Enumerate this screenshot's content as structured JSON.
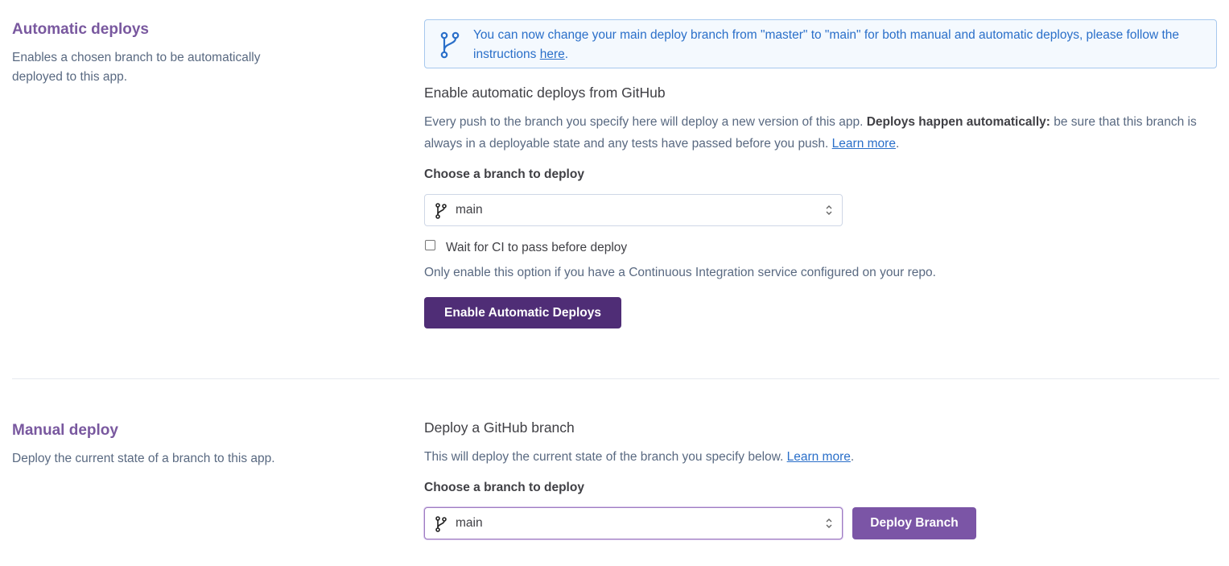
{
  "automatic": {
    "title": "Automatic deploys",
    "description": "Enables a chosen branch to be automatically deployed to this app.",
    "banner": {
      "text_before": "You can now change your main deploy branch from \"master\" to \"main\" for both manual and automatic deploys, please follow the instructions ",
      "link": "here",
      "text_after": "."
    },
    "heading": "Enable automatic deploys from GitHub",
    "para_before": "Every push to the branch you specify here will deploy a new version of this app. ",
    "para_bold": "Deploys happen automatically:",
    "para_after": " be sure that this branch is always in a deployable state and any tests have passed before you push. ",
    "learn_more": "Learn more",
    "period": ".",
    "branch_label": "Choose a branch to deploy",
    "branch_value": "main",
    "ci_label": "Wait for CI to pass before deploy",
    "ci_note": "Only enable this option if you have a Continuous Integration service configured on your repo.",
    "button": "Enable Automatic Deploys"
  },
  "manual": {
    "title": "Manual deploy",
    "description": "Deploy the current state of a branch to this app.",
    "heading": "Deploy a GitHub branch",
    "para": "This will deploy the current state of the branch you specify below. ",
    "learn_more": "Learn more",
    "period": ".",
    "branch_label": "Choose a branch to deploy",
    "branch_value": "main",
    "button": "Deploy Branch"
  },
  "colors": {
    "accent": "#79589f",
    "primary_button": "#4f2d76",
    "secondary_button": "#7b55a6",
    "link": "#2a6fc9",
    "banner_bg": "#f4f9fe"
  }
}
